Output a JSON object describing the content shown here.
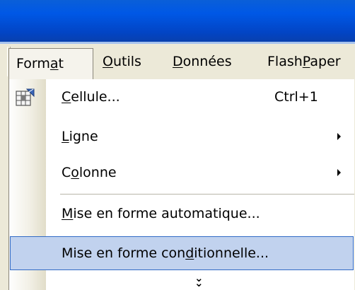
{
  "menubar": {
    "items": [
      {
        "label": "Format",
        "mnemonic_index": 4
      },
      {
        "label": "Outils",
        "mnemonic_index": 0
      },
      {
        "label": "Données",
        "mnemonic_index": 0
      },
      {
        "label": "FlashPaper",
        "mnemonic_index": 5
      }
    ]
  },
  "dropdown": {
    "items": [
      {
        "label": "Cellule...",
        "mnemonic_index": 0,
        "shortcut": "Ctrl+1",
        "icon": "format-cells-icon"
      },
      {
        "label": "Ligne",
        "mnemonic_index": 0,
        "submenu": true
      },
      {
        "label": "Colonne",
        "mnemonic_index": 1,
        "submenu": true
      },
      {
        "label": "Mise en forme automatique...",
        "mnemonic_index": 0
      },
      {
        "label": "Mise en forme conditionnelle...",
        "mnemonic_index": 17,
        "highlighted": true
      }
    ],
    "expand_icon": "chevron-double-down-icon"
  },
  "colors": {
    "titlebar": "#0058e6",
    "menubar_bg": "#ece9d8",
    "highlight_bg": "#c1d2ee",
    "highlight_border": "#316ac5"
  }
}
